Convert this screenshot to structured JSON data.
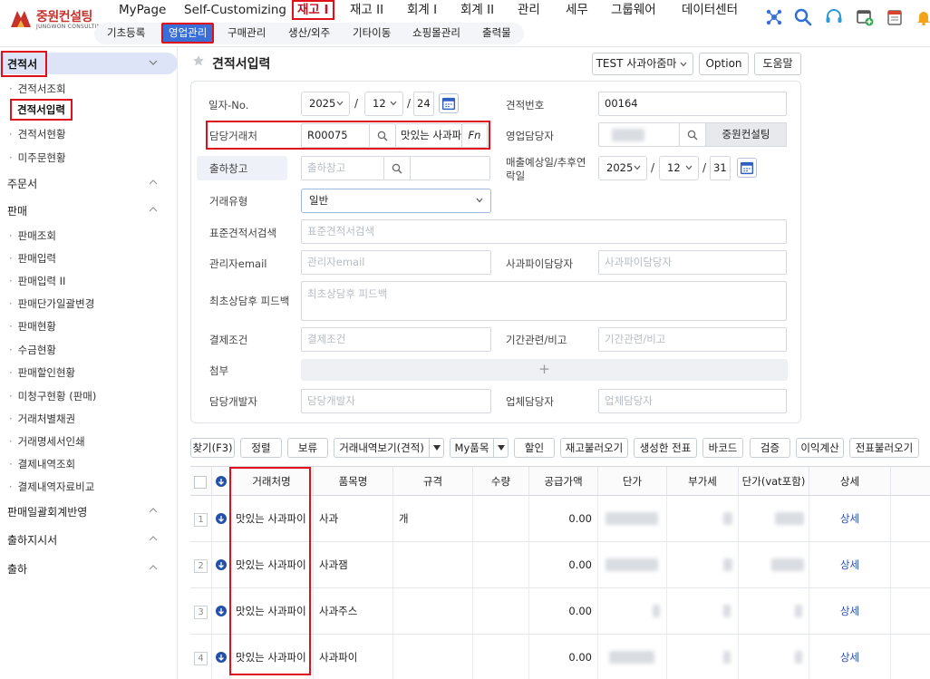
{
  "logo": {
    "name": "중원컨설팅",
    "sub": "JUNGWON CONSULTING"
  },
  "main_menu": [
    "MyPage",
    "Self-Customizing",
    "재고 I",
    "재고 II",
    "회계 I",
    "회계 II",
    "관리",
    "세무",
    "그룹웨어",
    "데이터센터"
  ],
  "sub_menu": [
    "기초등록",
    "영업관리",
    "구매관리",
    "생산/외주",
    "기타이동",
    "쇼핑몰관리",
    "출력물"
  ],
  "sidebar": {
    "group_estimate": "견적서",
    "items_estimate": [
      "견적서조회",
      "견적서입력",
      "견적서현황",
      "미주문현황"
    ],
    "group_order": "주문서",
    "group_sales": "판매",
    "items_sales": [
      "판매조회",
      "판매입력",
      "판매입력 II",
      "판매단가일괄변경",
      "판매현황",
      "수금현황",
      "판매할인현황",
      "미청구현황 (판매)",
      "거래처별채권",
      "거래명세서인쇄",
      "결제내역조회",
      "결제내역자료비교"
    ],
    "group_batch": "판매일괄회계반영",
    "group_shipreq": "출하지시서",
    "group_ship": "출하"
  },
  "page": {
    "title": "견적서입력"
  },
  "header_buttons": {
    "company": "TEST 사과아줌마",
    "option": "Option",
    "help": "도움말"
  },
  "form": {
    "date_label": "일자-No.",
    "date": {
      "year": "2025",
      "month": "12",
      "day": "24"
    },
    "estimate_no_label": "견적번호",
    "estimate_no": "00164",
    "customer_label": "담당거래처",
    "customer_code": "R00075",
    "customer_name": "맛있는 사과파이",
    "fn_label": "Fn",
    "sales_rep_label": "영업담당자",
    "sales_rep_name": "중원컨설팅",
    "warehouse_label": "출하창고",
    "warehouse_placeholder": "출하창고",
    "sales_date_label_1": "매출예상일/추후연",
    "sales_date_label_2": "락일",
    "sales_date": {
      "year": "2025",
      "month": "12",
      "day": "31"
    },
    "trade_type_label": "거래유형",
    "trade_type_value": "일반",
    "std_search_label": "표준견적서검색",
    "std_search_placeholder": "표준견적서검색",
    "manager_email_label": "관리자email",
    "manager_email_placeholder": "관리자email",
    "applepie_rep_label": "사과파이담당자",
    "applepie_rep_placeholder": "사과파이담당자",
    "feedback_label": "최초상담후 피드백",
    "feedback_placeholder": "최초상담후 피드백",
    "payment_label": "결제조건",
    "payment_placeholder": "결제조건",
    "period_label": "기간관련/비고",
    "period_placeholder": "기간관련/비고",
    "attach_label": "첨부",
    "attach_plus": "+",
    "developer_label": "담당개발자",
    "developer_placeholder": "담당개발자",
    "vendor_rep_label": "업체담당자",
    "vendor_rep_placeholder": "업체담당자"
  },
  "toolbar": [
    "찾기(F3)",
    "정렬",
    "보류",
    "거래내역보기(견적)",
    "My품목",
    "할인",
    "재고불러오기",
    "생성한 전표",
    "바코드",
    "검증",
    "이익계산",
    "전표불러오기"
  ],
  "grid": {
    "headers": [
      "거래처명",
      "품목명",
      "규격",
      "수량",
      "공급가액",
      "단가",
      "부가세",
      "단가(vat포함)",
      "상세"
    ],
    "rows": [
      {
        "num": "1",
        "customer": "맛있는 사과파이",
        "item": "사과",
        "spec": "개",
        "qty": "",
        "supply": "0.00",
        "detail": "상세"
      },
      {
        "num": "2",
        "customer": "맛있는 사과파이",
        "item": "사과잼",
        "spec": "",
        "qty": "",
        "supply": "0.00",
        "detail": "상세"
      },
      {
        "num": "3",
        "customer": "맛있는 사과파이",
        "item": "사과주스",
        "spec": "",
        "qty": "",
        "supply": "0.00",
        "detail": "상세"
      },
      {
        "num": "4",
        "customer": "맛있는 사과파이",
        "item": "사과파이",
        "spec": "",
        "qty": "",
        "supply": "0.00",
        "detail": "상세"
      }
    ]
  },
  "icons": [
    "puzzle-icon",
    "search-icon",
    "headset-icon",
    "add-window-icon",
    "calendar-note-icon",
    "bell-icon",
    "star-icon",
    "calendar-icon",
    "chevron-down-icon"
  ],
  "colors": {
    "accent_red": "#e0101a",
    "active_blue": "#3a6fd8",
    "link_blue": "#2a4fb8",
    "sidebar_active": "#dde4f7"
  }
}
